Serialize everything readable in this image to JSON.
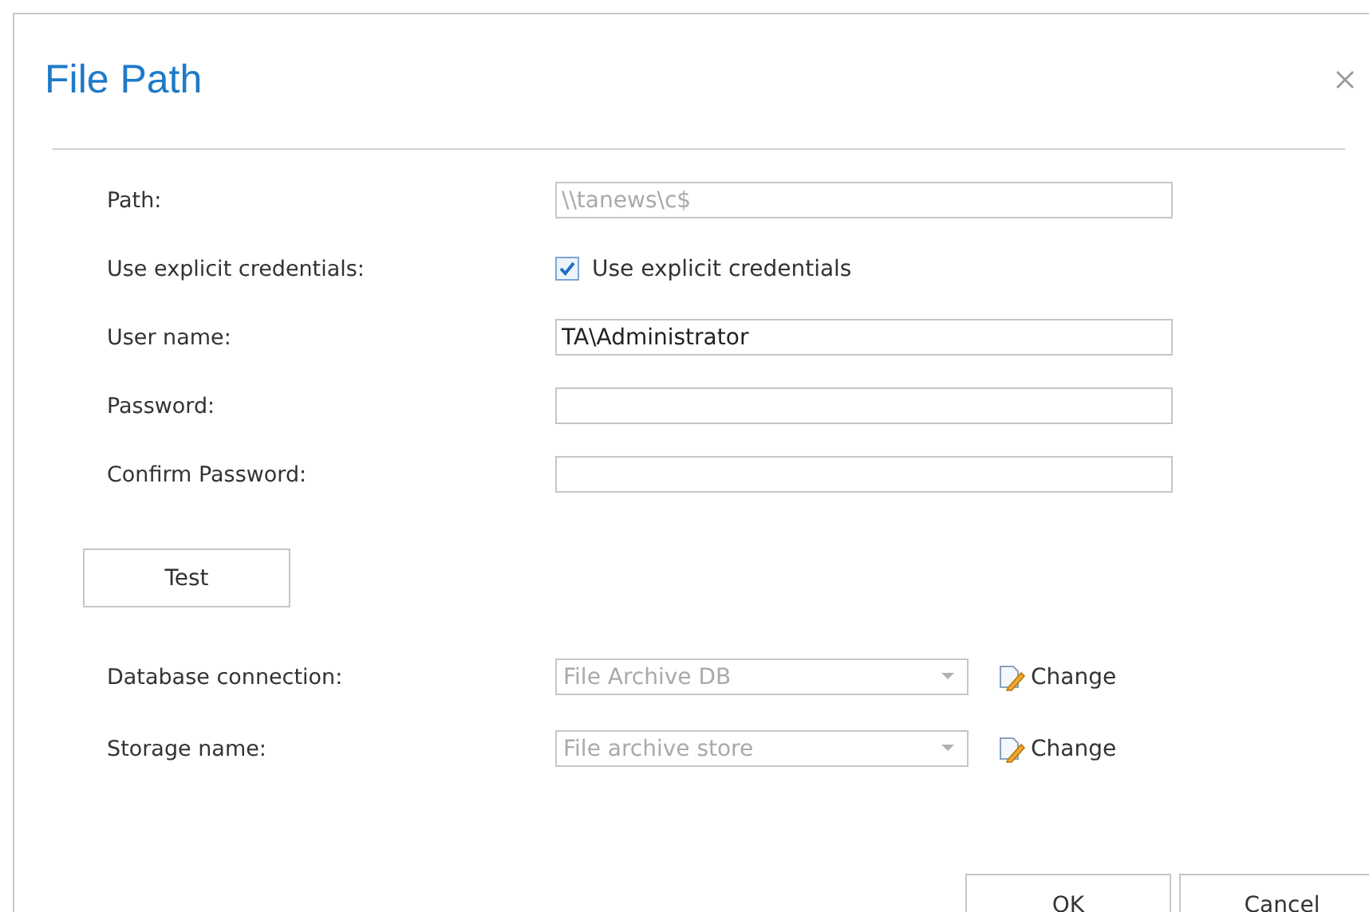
{
  "dialog": {
    "title": "File Path"
  },
  "fields": [
    {
      "kind": "text",
      "label": "Path:",
      "value": "\\\\tanews\\c$",
      "disabled": true
    },
    {
      "kind": "checkbox",
      "label": "Use explicit credentials:",
      "checkbox_label": "Use explicit credentials",
      "checked": true
    },
    {
      "kind": "text",
      "label": "User name:",
      "value": "TA\\Administrator"
    },
    {
      "kind": "text",
      "label": "Password:"
    },
    {
      "kind": "text",
      "label": "Confirm Password:"
    }
  ],
  "test_button": "Test",
  "selects": [
    {
      "label": "Database connection:",
      "value": "File Archive DB",
      "disabled": true,
      "action": "Change"
    },
    {
      "label": "Storage name:",
      "value": "File archive store",
      "disabled": true,
      "action": "Change"
    }
  ],
  "buttons": [
    "OK",
    "Cancel"
  ]
}
